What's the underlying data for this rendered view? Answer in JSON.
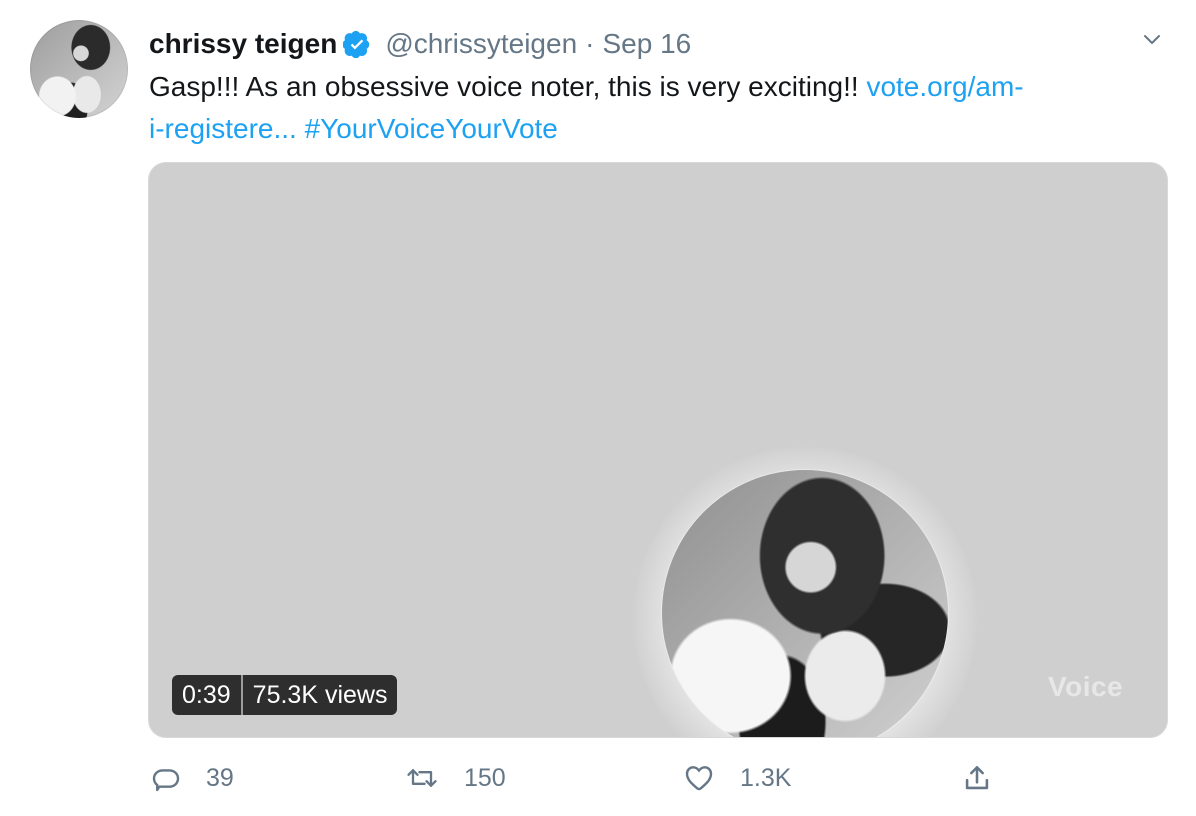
{
  "tweet": {
    "author_name": "chrissy teigen",
    "handle": "@chrissyteigen",
    "separator": "·",
    "date": "Sep 16",
    "text_main": "Gasp!!! As an obsessive voice noter, this is very exciting!! ",
    "link_part1": "vote.org/am-",
    "link_part2": "i-registere...",
    "hashtag": "#YourVoiceYourVote",
    "icons": {
      "verified": "verified-badge-icon",
      "menu": "chevron-down-icon",
      "reply": "reply-icon",
      "retweet": "retweet-icon",
      "like": "heart-icon",
      "share": "share-icon"
    }
  },
  "media": {
    "duration": "0:39",
    "views": "75.3K views",
    "watermark": "Voice"
  },
  "actions": {
    "reply_count": "39",
    "retweet_count": "150",
    "like_count": "1.3K"
  },
  "colors": {
    "accent": "#1da1f2",
    "muted": "#657786",
    "text": "#14171a",
    "media_bg": "#cfcfcf"
  }
}
